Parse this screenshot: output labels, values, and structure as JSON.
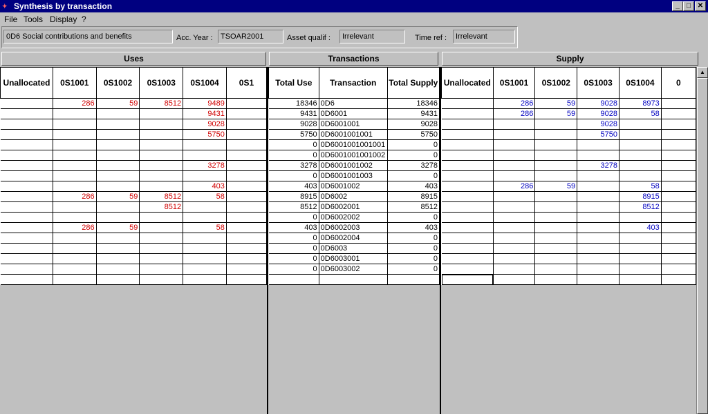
{
  "window": {
    "title": "Synthesis by transaction",
    "app_icon_glyph": "✦",
    "min_glyph": "_",
    "max_glyph": "□",
    "close_glyph": "✕"
  },
  "menu": [
    "File",
    "Tools",
    "Display",
    "?"
  ],
  "info": {
    "account": "0D6 Social contributions and benefits",
    "acc_year_label": "Acc. Year :",
    "acc_year": "TSOAR2001",
    "asset_label": "Asset qualif :",
    "asset_value": "Irrelevant",
    "timeref_label": "Time ref :",
    "timeref_value": "Irrelevant"
  },
  "sections": {
    "uses": "Uses",
    "transactions": "Transactions",
    "supply": "Supply"
  },
  "uses": {
    "headers": [
      "Unallocated",
      "0S1001",
      "0S1002",
      "0S1003",
      "0S1004",
      "0S1"
    ],
    "rows": [
      [
        "",
        "286",
        "59",
        "8512",
        "9489",
        ""
      ],
      [
        "",
        "",
        "",
        "",
        "9431",
        ""
      ],
      [
        "",
        "",
        "",
        "",
        "9028",
        ""
      ],
      [
        "",
        "",
        "",
        "",
        "5750",
        ""
      ],
      [
        "",
        "",
        "",
        "",
        "",
        ""
      ],
      [
        "",
        "",
        "",
        "",
        "",
        ""
      ],
      [
        "",
        "",
        "",
        "",
        "3278",
        ""
      ],
      [
        "",
        "",
        "",
        "",
        "",
        ""
      ],
      [
        "",
        "",
        "",
        "",
        "403",
        ""
      ],
      [
        "",
        "286",
        "59",
        "8512",
        "58",
        ""
      ],
      [
        "",
        "",
        "",
        "8512",
        "",
        ""
      ],
      [
        "",
        "",
        "",
        "",
        "",
        ""
      ],
      [
        "",
        "286",
        "59",
        "",
        "58",
        ""
      ],
      [
        "",
        "",
        "",
        "",
        "",
        ""
      ],
      [
        "",
        "",
        "",
        "",
        "",
        ""
      ],
      [
        "",
        "",
        "",
        "",
        "",
        ""
      ],
      [
        "",
        "",
        "",
        "",
        "",
        ""
      ],
      [
        "",
        "",
        "",
        "",
        "",
        ""
      ]
    ]
  },
  "transactions": {
    "headers": [
      "Total Use",
      "Transaction",
      "Total Supply"
    ],
    "rows": [
      [
        "18346",
        "0D6",
        "18346"
      ],
      [
        "9431",
        "0D6001",
        "9431"
      ],
      [
        "9028",
        "0D6001001",
        "9028"
      ],
      [
        "5750",
        "0D6001001001",
        "5750"
      ],
      [
        "0",
        "0D6001001001001",
        "0"
      ],
      [
        "0",
        "0D6001001001002",
        "0"
      ],
      [
        "3278",
        "0D6001001002",
        "3278"
      ],
      [
        "0",
        "0D6001001003",
        "0"
      ],
      [
        "403",
        "0D6001002",
        "403"
      ],
      [
        "8915",
        "0D6002",
        "8915"
      ],
      [
        "8512",
        "0D6002001",
        "8512"
      ],
      [
        "0",
        "0D6002002",
        "0"
      ],
      [
        "403",
        "0D6002003",
        "403"
      ],
      [
        "0",
        "0D6002004",
        "0"
      ],
      [
        "0",
        "0D6003",
        "0"
      ],
      [
        "0",
        "0D6003001",
        "0"
      ],
      [
        "0",
        "0D6003002",
        "0"
      ],
      [
        "",
        "",
        ""
      ]
    ]
  },
  "supply": {
    "headers": [
      "Unallocated",
      "0S1001",
      "0S1002",
      "0S1003",
      "0S1004",
      "0"
    ],
    "rows": [
      [
        "",
        "286",
        "59",
        "9028",
        "8973",
        ""
      ],
      [
        "",
        "286",
        "59",
        "9028",
        "58",
        ""
      ],
      [
        "",
        "",
        "",
        "9028",
        "",
        ""
      ],
      [
        "",
        "",
        "",
        "5750",
        "",
        ""
      ],
      [
        "",
        "",
        "",
        "",
        "",
        ""
      ],
      [
        "",
        "",
        "",
        "",
        "",
        ""
      ],
      [
        "",
        "",
        "",
        "3278",
        "",
        ""
      ],
      [
        "",
        "",
        "",
        "",
        "",
        ""
      ],
      [
        "",
        "286",
        "59",
        "",
        "58",
        ""
      ],
      [
        "",
        "",
        "",
        "",
        "8915",
        ""
      ],
      [
        "",
        "",
        "",
        "",
        "8512",
        ""
      ],
      [
        "",
        "",
        "",
        "",
        "",
        ""
      ],
      [
        "",
        "",
        "",
        "",
        "403",
        ""
      ],
      [
        "",
        "",
        "",
        "",
        "",
        ""
      ],
      [
        "",
        "",
        "",
        "",
        "",
        ""
      ],
      [
        "",
        "",
        "",
        "",
        "",
        ""
      ],
      [
        "",
        "",
        "",
        "",
        "",
        ""
      ],
      [
        "",
        "",
        "",
        "",
        "",
        ""
      ]
    ]
  },
  "scrollbar": {
    "up_glyph": "▲"
  },
  "colors": {
    "uses_values": "#d00000",
    "supply_values": "#0000c0",
    "titlebar": "#000080"
  }
}
